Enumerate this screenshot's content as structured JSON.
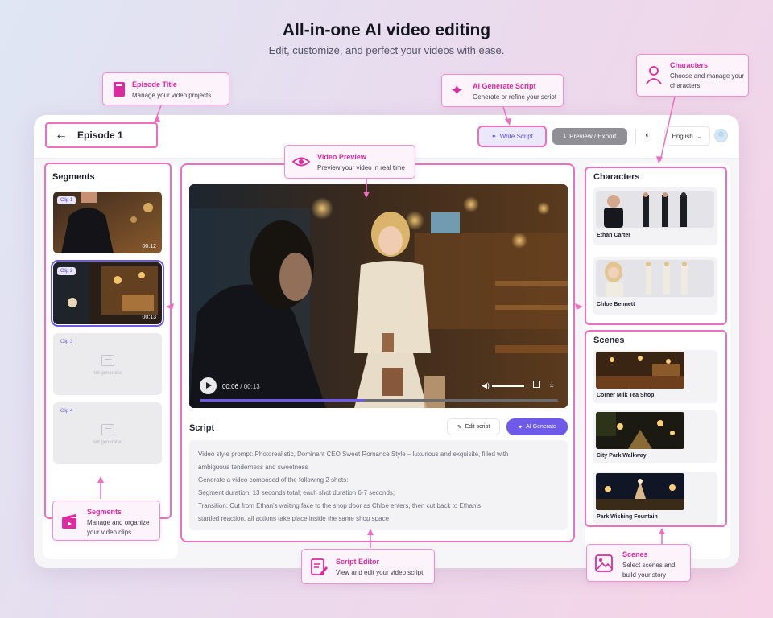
{
  "hero": {
    "title": "All-in-one AI video editing",
    "subtitle": "Edit, customize, and perfect your videos with ease."
  },
  "callouts": {
    "episode_title": {
      "title": "Episode Title",
      "desc": "Manage your video projects"
    },
    "ai_generate_script": {
      "title": "AI Generate Script",
      "desc": "Generate or refine your script"
    },
    "characters": {
      "title": "Characters",
      "desc": "Choose and manage your characters"
    },
    "video_preview": {
      "title": "Video Preview",
      "desc": "Preview your video in real time"
    },
    "segments": {
      "title": "Segments",
      "desc": "Manage and organize your video clips"
    },
    "script_editor": {
      "title": "Script Editor",
      "desc": "View and edit your video script"
    },
    "scenes": {
      "title": "Scenes",
      "desc": "Select scenes and build your story"
    }
  },
  "topbar": {
    "episode": "Episode 1",
    "write_script": "Write Script",
    "export": "Preview / Export",
    "language": "English"
  },
  "segments": {
    "title": "Segments",
    "clips": [
      {
        "badge": "Clip 1",
        "duration": "00:12",
        "generated": true
      },
      {
        "badge": "Clip 2",
        "duration": "00:13",
        "generated": true,
        "selected": true
      },
      {
        "badge": "Clip 3",
        "note": "Not generated",
        "generated": false
      },
      {
        "badge": "Clip 4",
        "note": "Not generated",
        "generated": false
      }
    ]
  },
  "player": {
    "current": "00:06",
    "total": "00:13",
    "progress": 0.46
  },
  "script": {
    "label": "Script",
    "edit_button": "Edit script",
    "ai_button": "AI Generate",
    "lines": [
      "Video style prompt: Photorealistic, Dominant CEO Sweet Romance Style – luxurious and exquisite, filled with",
      "ambiguous tenderness and sweetness",
      "Generate a video composed of the following 2 shots:",
      "Segment duration: 13 seconds total; each shot duration 6-7 seconds;",
      "Transition: Cut from Ethan's waiting face to the shop door as Chloe enters, then cut back to Ethan's",
      "startled reaction, all actions take place inside the same shop space"
    ]
  },
  "characters": {
    "title": "Characters",
    "items": [
      {
        "name": "Ethan Carter"
      },
      {
        "name": "Chloe Bennett"
      }
    ]
  },
  "scenes": {
    "title": "Scenes",
    "items": [
      {
        "name": "Corner Milk Tea Shop"
      },
      {
        "name": "City Park Walkway"
      },
      {
        "name": "Park Wishing Fountain"
      }
    ]
  },
  "colors": {
    "accent": "#6d5ae8",
    "callout_border": "#ec6fc1",
    "callout_title": "#dd2a9f"
  }
}
